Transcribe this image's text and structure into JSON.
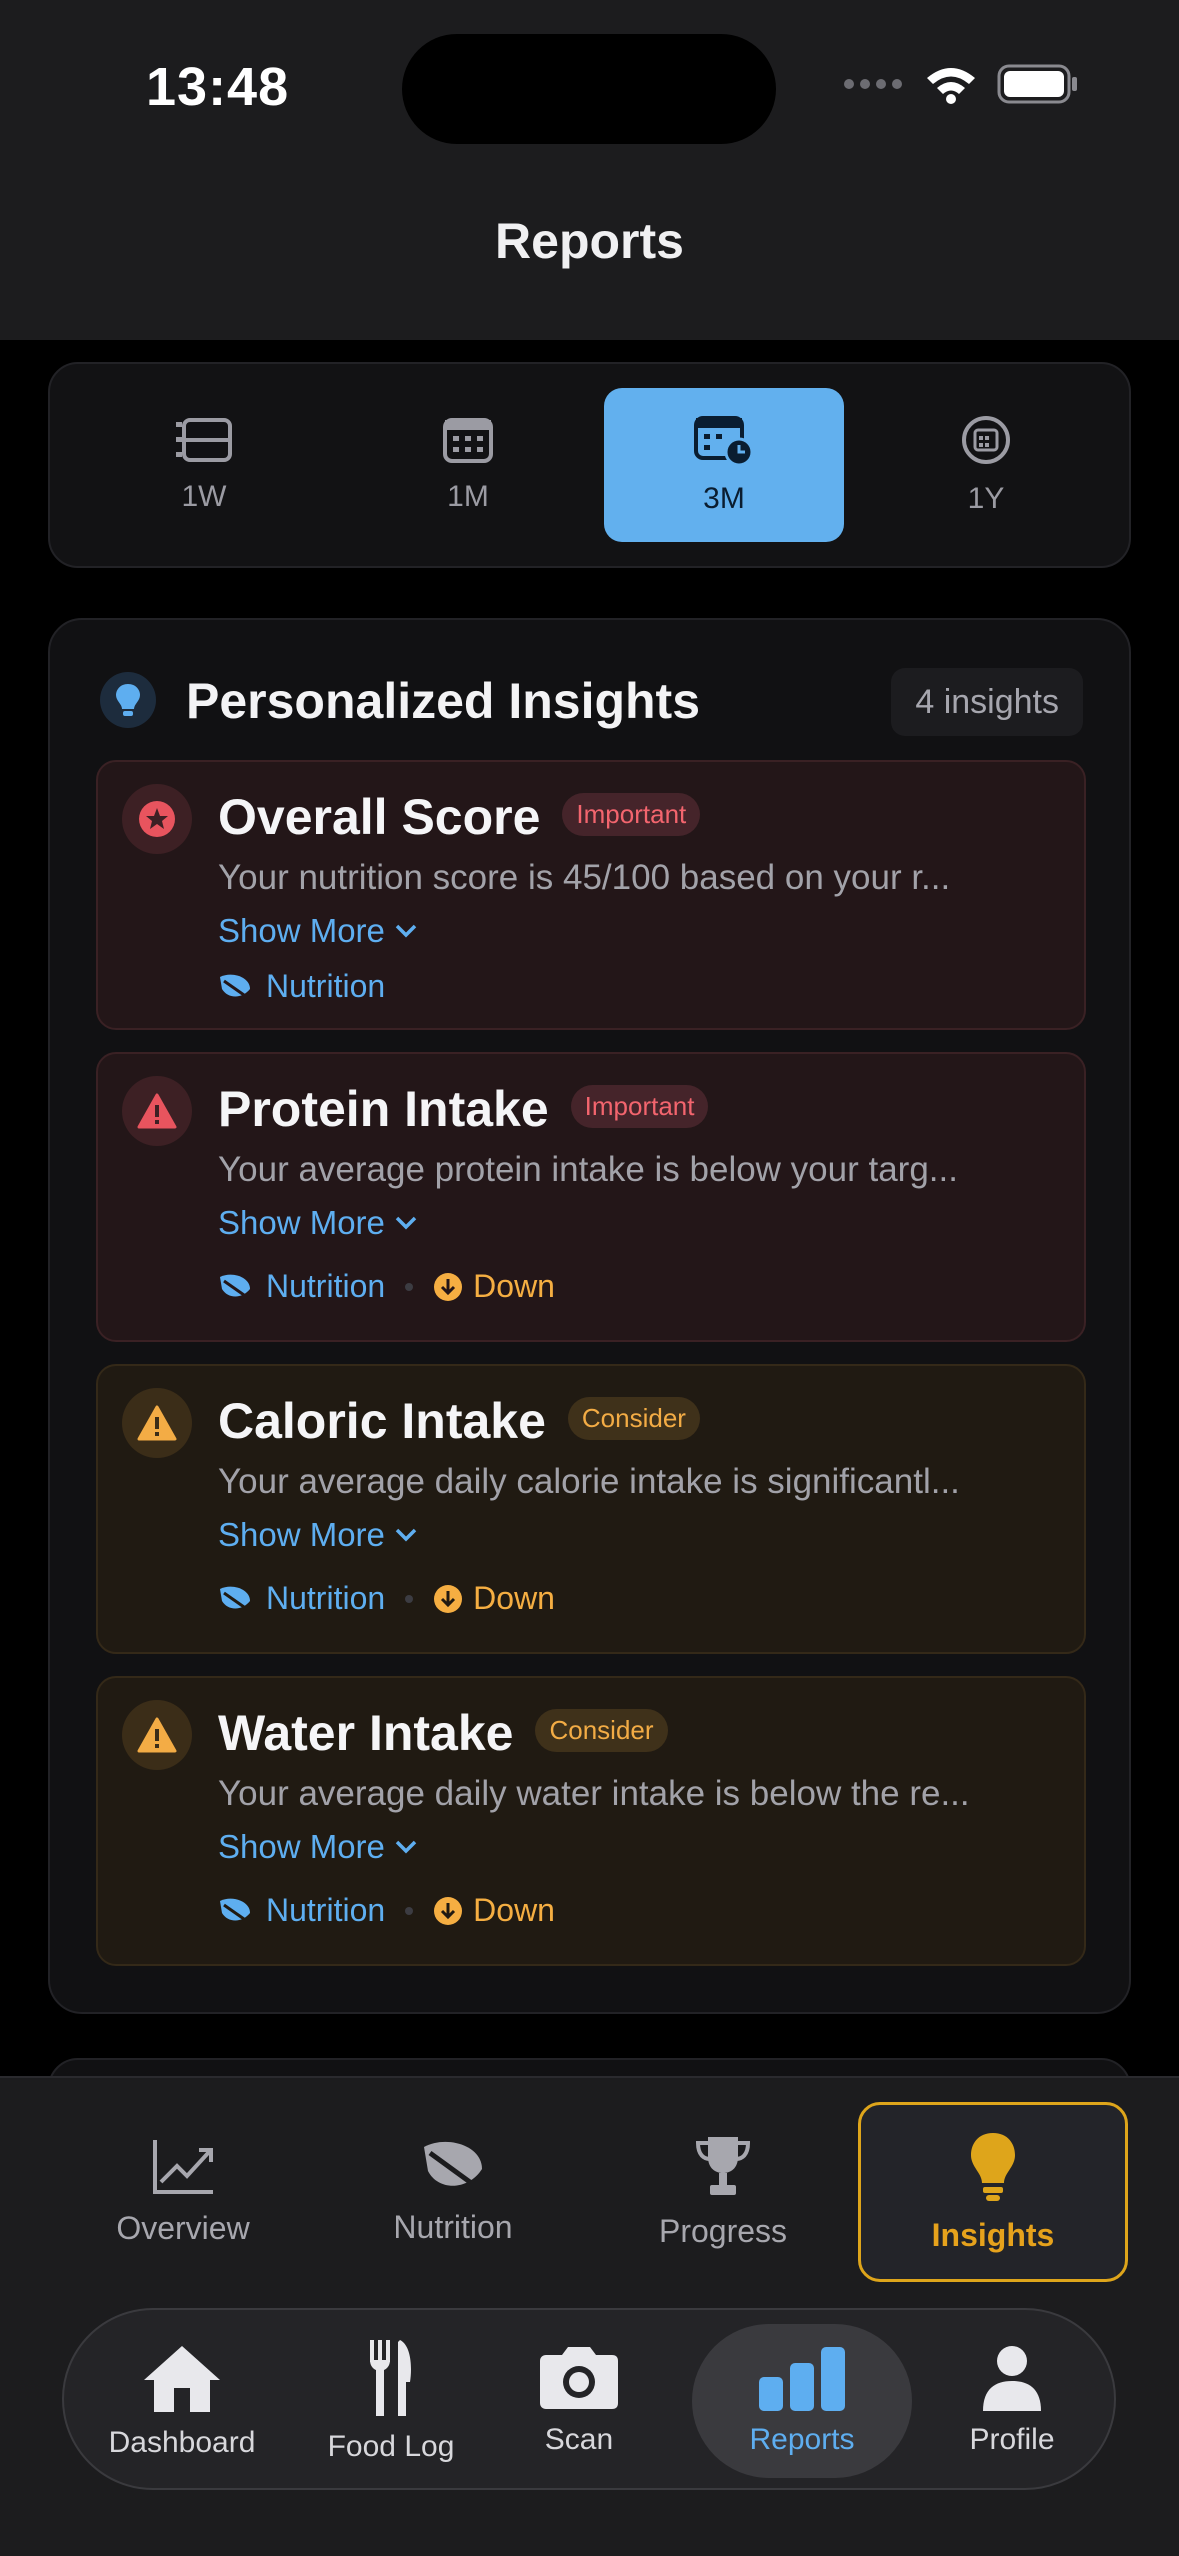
{
  "status_bar": {
    "time": "13:48"
  },
  "header": {
    "title": "Reports"
  },
  "periods": [
    {
      "label": "1W",
      "icon": "list-icon"
    },
    {
      "label": "1M",
      "icon": "calendar-icon"
    },
    {
      "label": "3M",
      "icon": "calendar-clock-icon",
      "selected": true
    },
    {
      "label": "1Y",
      "icon": "circle-calendar-icon"
    }
  ],
  "insights": {
    "title": "Personalized Insights",
    "count": "4 insights",
    "items": [
      {
        "title": "Overall Score",
        "badge": "Important",
        "severity": "important",
        "icon": "star-icon",
        "description": "Your nutrition score is 45/100 based on your r...",
        "show_more": "Show More",
        "category": "Nutrition",
        "trend": ""
      },
      {
        "title": "Protein Intake",
        "badge": "Important",
        "severity": "important",
        "icon": "warning-icon",
        "description": "Your average protein intake is below your targ...",
        "show_more": "Show More",
        "category": "Nutrition",
        "trend": "Down"
      },
      {
        "title": "Caloric Intake",
        "badge": "Consider",
        "severity": "consider",
        "icon": "warning-icon",
        "description": "Your average daily calorie intake is significantl...",
        "show_more": "Show More",
        "category": "Nutrition",
        "trend": "Down"
      },
      {
        "title": "Water Intake",
        "badge": "Consider",
        "severity": "consider",
        "icon": "warning-icon",
        "description": "Your average daily water intake is below the re...",
        "show_more": "Show More",
        "category": "Nutrition",
        "trend": "Down"
      }
    ]
  },
  "sub_tabs": [
    {
      "label": "Overview",
      "icon": "chart-line-icon"
    },
    {
      "label": "Nutrition",
      "icon": "leaf-icon"
    },
    {
      "label": "Progress",
      "icon": "trophy-icon"
    },
    {
      "label": "Insights",
      "icon": "lightbulb-icon",
      "selected": true
    }
  ],
  "bottom_nav": [
    {
      "label": "Dashboard",
      "icon": "house-icon"
    },
    {
      "label": "Food Log",
      "icon": "fork-knife-icon"
    },
    {
      "label": "Scan",
      "icon": "camera-icon"
    },
    {
      "label": "Reports",
      "icon": "bar-chart-icon",
      "selected": true
    },
    {
      "label": "Profile",
      "icon": "person-icon"
    }
  ],
  "colors": {
    "accent_blue": "#62b0ee",
    "important_red": "#f3656e",
    "consider_amber": "#f3ac45",
    "insights_gold": "#dea51b"
  }
}
